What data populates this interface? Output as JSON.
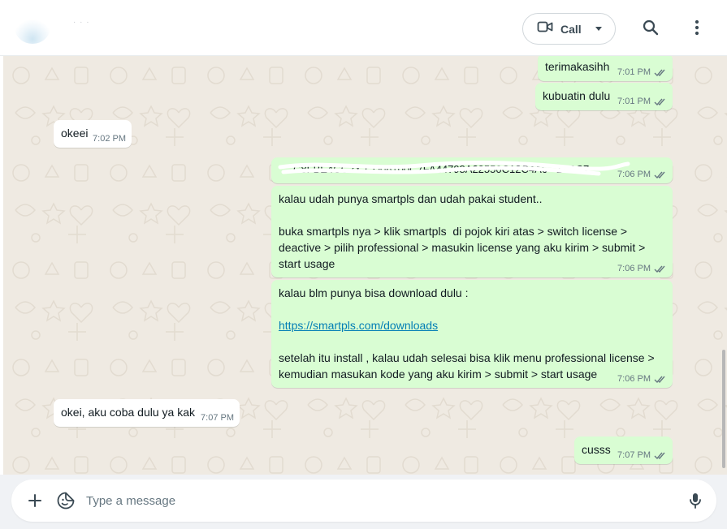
{
  "header": {
    "contact_name": "· · ·",
    "call_label": "Call",
    "icons": {
      "video": "video-camera-icon",
      "caret": "chevron-down-icon",
      "search": "search-icon",
      "menu": "kebab-menu-icon"
    }
  },
  "messages": [
    {
      "direction": "out",
      "text": "terimakasihh",
      "time": "7:01 PM",
      "status": "read"
    },
    {
      "direction": "out",
      "text": "kubuatin dulu",
      "time": "7:01 PM",
      "status": "read"
    },
    {
      "direction": "in",
      "text": "okeei",
      "time": "7:02 PM"
    },
    {
      "direction": "out",
      "text": "     C8FBE4CC2X-CD06100C7FA44798A22550C12C4A6   1C0C7",
      "time": "7:06 PM",
      "status": "read",
      "redacted": true
    },
    {
      "direction": "out",
      "text": "kalau udah punya smartpls dan udah pakai student..\n\nbuka smartpls nya > klik smartpls  di pojok kiri atas > switch license >\ndeactive > pilih professional > masukin license yang aku kirim > submit >\nstart usage",
      "time": "7:06 PM",
      "status": "read"
    },
    {
      "direction": "out",
      "text_before": "kalau blm punya bisa download dulu :\n\n",
      "link": "https://smartpls.com/downloads",
      "text_after": "\n\nsetelah itu install , kalau udah selesai bisa klik menu professional license >\nkemudian masukan kode yang aku kirim > submit > start usage",
      "time": "7:06 PM",
      "status": "read"
    },
    {
      "direction": "in",
      "text": "okei, aku coba dulu ya kak",
      "time": "7:07 PM"
    },
    {
      "direction": "out",
      "text": "cusss",
      "time": "7:07 PM",
      "status": "read"
    }
  ],
  "composer": {
    "placeholder": "Type a message",
    "icons": {
      "attach": "plus-icon",
      "sticker": "sticker-icon",
      "mic": "microphone-icon"
    }
  },
  "colors": {
    "outgoing_bubble": "#d9fdd3",
    "incoming_bubble": "#ffffff",
    "chat_background": "#efeae2",
    "link": "#027eb5",
    "meta_text": "#667781"
  }
}
